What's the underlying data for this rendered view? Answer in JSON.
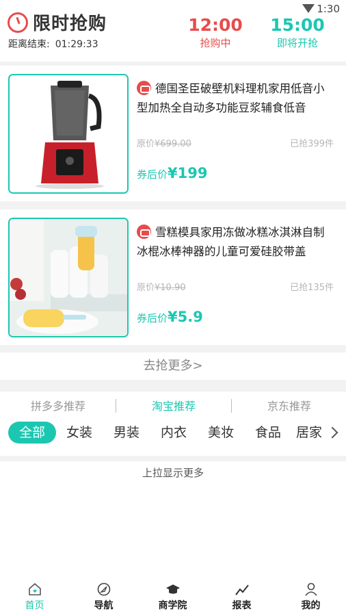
{
  "status_bar": {
    "time": "1:30"
  },
  "flash_sale": {
    "title": "限时抢购",
    "countdown_label": "距离结束:",
    "countdown_value": "01:29:33",
    "slots": [
      {
        "time": "12:00",
        "status": "抢购中"
      },
      {
        "time": "15:00",
        "status": "即将开抢"
      }
    ]
  },
  "products": [
    {
      "name": "德国圣臣破壁机料理机家用低音小型加热全自动多功能豆浆辅食低音",
      "original_price_label": "原价",
      "original_price": "¥699.00",
      "sold": "已抢399件",
      "coupon_label": "券后价",
      "coupon_price": "¥199"
    },
    {
      "name": "雪糕模具家用冻做冰糕冰淇淋自制冰棍冰棒神器的儿童可爱硅胶带盖",
      "original_price_label": "原价",
      "original_price": "¥10.90",
      "sold": "已抢135件",
      "coupon_label": "券后价",
      "coupon_price": "¥5.9"
    }
  ],
  "more_link": "去抢更多>",
  "source_tabs": [
    "拼多多推荐",
    "淘宝推荐",
    "京东推荐"
  ],
  "categories": [
    "全部",
    "女装",
    "男装",
    "内衣",
    "美妆",
    "食品",
    "居家"
  ],
  "pull_hint": "上拉显示更多",
  "tab_bar": [
    "首页",
    "导航",
    "商学院",
    "报表",
    "我的"
  ],
  "colors": {
    "accent": "#1bc7b1",
    "sale_red": "#e74c4c"
  }
}
